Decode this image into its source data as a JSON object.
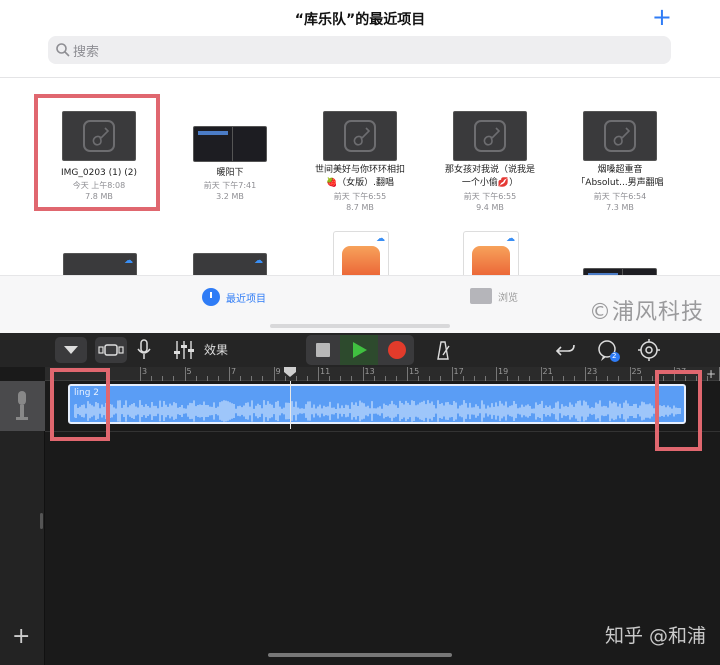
{
  "files": {
    "title": "“库乐队”的最近项目",
    "search_placeholder": "搜索",
    "items": [
      {
        "name": "IMG_0203 (1) (2)",
        "date": "今天 上午8:08",
        "size": "7.8 MB",
        "type": "garageband"
      },
      {
        "name": "暖阳下",
        "date": "前天 下午7:41",
        "size": "3.2 MB",
        "type": "video"
      },
      {
        "name": "世间美好与你环环相扣",
        "name2": "🍓（女版）.翻唱",
        "date": "前天 下午6:55",
        "size": "8.7 MB",
        "type": "garageband"
      },
      {
        "name": "那女孩对我说（说我是",
        "name2": "一个小偷💋）",
        "date": "前天 下午6:55",
        "size": "9.4 MB",
        "type": "garageband"
      },
      {
        "name": "烟嗓超重音",
        "name2": "「Absolut...男声翻唱",
        "date": "前天 下午6:54",
        "size": "7.3 MB",
        "type": "garageband"
      }
    ],
    "tabs": {
      "recent": "最近项目",
      "browse": "浏览"
    },
    "watermark": "©浦风科技"
  },
  "garageband": {
    "effects_label": "效果",
    "region_name": "ling 2",
    "ruler_ticks": [
      "3",
      "5",
      "7",
      "9",
      "11",
      "13",
      "15",
      "17",
      "19",
      "21",
      "23",
      "25",
      "27",
      "29",
      "31"
    ],
    "badge_count": "2",
    "watermark": "知乎 @和浦"
  },
  "colors": {
    "accent_blue": "#2f7cf6",
    "highlight_red": "#e0676f",
    "region_blue": "#5a9df5",
    "record_red": "#e23b2b",
    "play_green": "#40c040"
  }
}
